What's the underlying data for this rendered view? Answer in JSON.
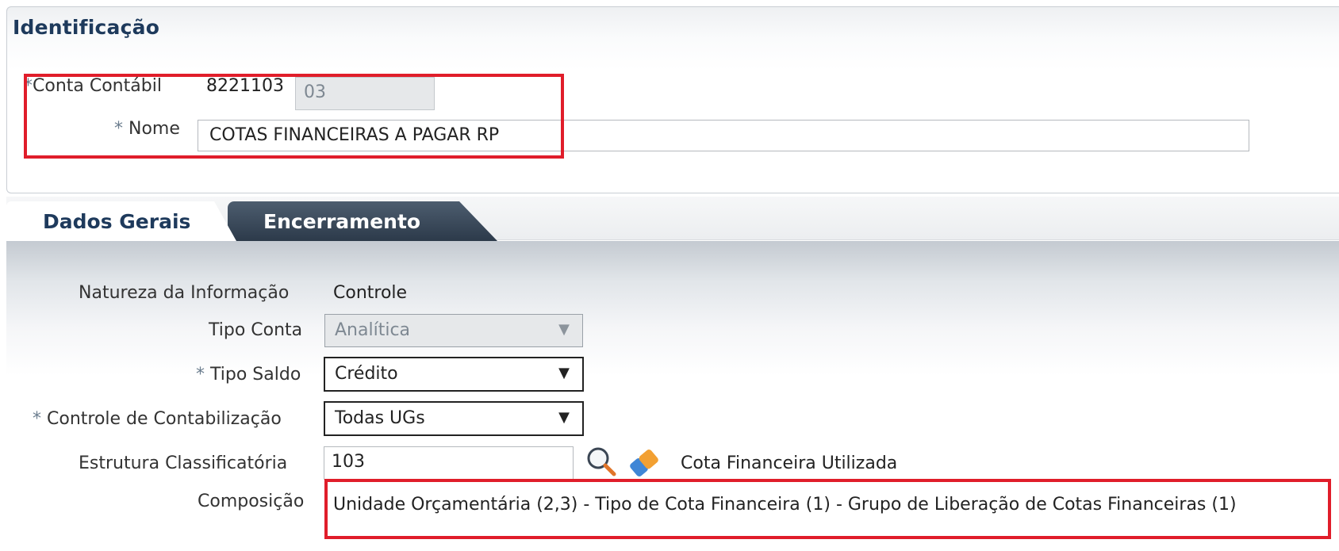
{
  "identificacao": {
    "title": "Identificação",
    "conta_contabil": {
      "required_mark": "*",
      "label": "Conta Contábil",
      "prefix": "8221103",
      "suffix": "03"
    },
    "nome": {
      "required_mark": "*",
      "label": "Nome",
      "value": "COTAS FINANCEIRAS A PAGAR RP"
    }
  },
  "tabs": [
    {
      "label": "Dados Gerais",
      "active": true
    },
    {
      "label": "Encerramento",
      "active": false
    }
  ],
  "dados_gerais": {
    "natureza": {
      "label": "Natureza da Informação",
      "value": "Controle"
    },
    "tipo_conta": {
      "label": "Tipo Conta",
      "value": "Analítica"
    },
    "tipo_saldo": {
      "required_mark": "*",
      "label": "Tipo Saldo",
      "value": "Crédito"
    },
    "controle_contabilizacao": {
      "required_mark": "*",
      "label": "Controle de Contabilização",
      "value": "Todas UGs"
    },
    "estrutura": {
      "label": "Estrutura Classificatória",
      "value": "103",
      "description": "Cota Financeira Utilizada"
    },
    "composicao": {
      "label": "Composição",
      "value": "Unidade Orçamentária (2,3) - Tipo de Cota Financeira (1) - Grupo de Liberação de Cotas Financeiras (1)"
    }
  },
  "icons": {
    "search": "search-icon",
    "clear": "eraser-icon",
    "dropdown": "chevron-down-icon"
  },
  "colors": {
    "title": "#1e3a5c",
    "highlight": "#e01d2a",
    "tab_inactive": "#3a4a5c"
  }
}
